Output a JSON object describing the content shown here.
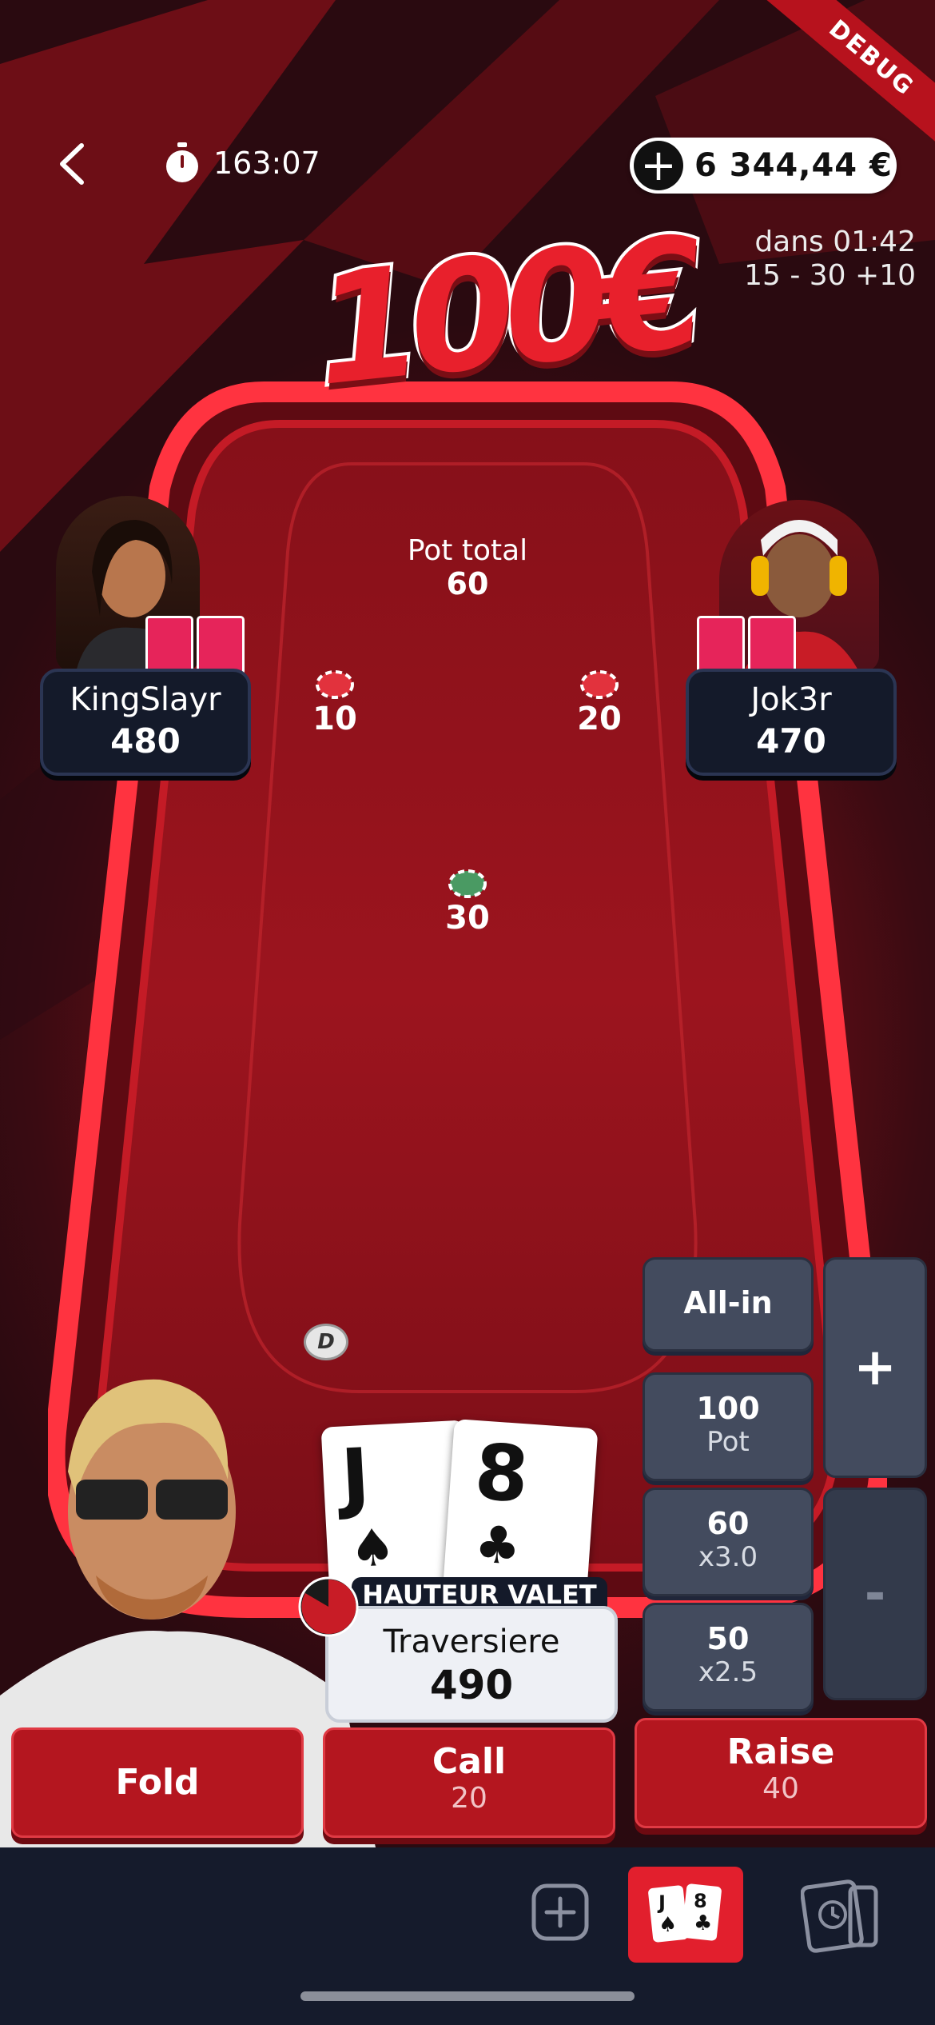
{
  "header": {
    "debug_label": "DEBUG",
    "timer": "163:07",
    "balance": "6 344,44 €",
    "level_countdown": "dans 01:42",
    "blinds": "15 - 30 +10"
  },
  "prize": "100€",
  "table": {
    "pot_label": "Pot total",
    "pot_value": "60",
    "center_chip": "30",
    "dealer_label": "D"
  },
  "opponents": [
    {
      "name": "KingSlayr",
      "stack": "480",
      "bet": "10"
    },
    {
      "name": "Jok3r",
      "stack": "470",
      "bet": "20"
    }
  ],
  "hero": {
    "name": "Traversiere",
    "stack": "490",
    "hand_name": "HAUTEUR VALET",
    "cards": [
      {
        "rank": "J",
        "suit": "♠"
      },
      {
        "rank": "8",
        "suit": "♣"
      }
    ]
  },
  "bet_sizes": [
    {
      "main": "All-in",
      "sub": ""
    },
    {
      "main": "100",
      "sub": "Pot"
    },
    {
      "main": "60",
      "sub": "x3.0"
    },
    {
      "main": "50",
      "sub": "x2.5"
    }
  ],
  "side_buttons": {
    "plus": "+",
    "minus": "-"
  },
  "actions": {
    "fold": {
      "label": "Fold"
    },
    "call": {
      "label": "Call",
      "value": "20"
    },
    "raise": {
      "label": "Raise",
      "value": "40"
    }
  },
  "nav": {
    "tables_card_ranks": [
      "J",
      "8"
    ],
    "tables_card_suits": [
      "♠",
      "♣"
    ]
  },
  "colors": {
    "accent": "#e21f2d",
    "table": "#8f121b",
    "panel": "#141a2a",
    "button": "#434b5e"
  }
}
